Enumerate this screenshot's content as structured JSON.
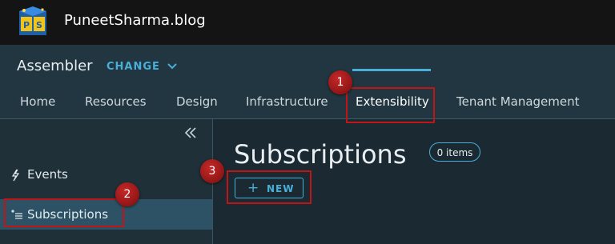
{
  "topbar": {
    "site_name": "PuneetSharma.blog",
    "logo_icon": "ps-logo-icon"
  },
  "header": {
    "app_title": "Assembler",
    "change_label": "CHANGE"
  },
  "nav": {
    "tabs": [
      {
        "label": "Home"
      },
      {
        "label": "Resources"
      },
      {
        "label": "Design"
      },
      {
        "label": "Infrastructure"
      },
      {
        "label": "Extensibility",
        "active": true
      },
      {
        "label": "Tenant Management"
      }
    ]
  },
  "sidebar": {
    "collapse_icon": "double-chevron-left-icon",
    "items": [
      {
        "label": "Events",
        "icon": "lightning-icon"
      },
      {
        "label": "Subscriptions",
        "icon": "list-tree-icon",
        "selected": true
      }
    ]
  },
  "main": {
    "title": "Subscriptions",
    "count_badge": "0 items",
    "new_label": "NEW"
  },
  "annotations": [
    "1",
    "2",
    "3"
  ],
  "colors": {
    "accent": "#49afd9",
    "highlight": "#c01515",
    "selected_bg": "#2d5266"
  }
}
